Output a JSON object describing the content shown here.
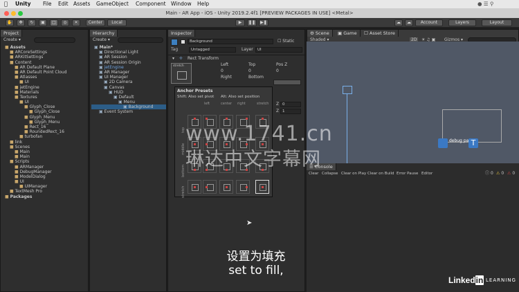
{
  "menubar": {
    "app": "Unity",
    "items": [
      "File",
      "Edit",
      "Assets",
      "GameObject",
      "Component",
      "Window",
      "Help"
    ]
  },
  "title": "Main - AR App - iOS - Unity 2019.2.4f1 [PREVIEW PACKAGES IN USE] <Metal>",
  "toolbar": {
    "center": "Center",
    "local": "Local",
    "account": "Account",
    "layers": "Layers",
    "layout": "Layout"
  },
  "project": {
    "tab": "Project",
    "create": "Create",
    "tree": [
      {
        "label": "Assets",
        "depth": 0,
        "bold": true
      },
      {
        "label": "ARCoreSettings",
        "depth": 1
      },
      {
        "label": "ARKitSettings",
        "depth": 1
      },
      {
        "label": "Content",
        "depth": 1
      },
      {
        "label": "AR Default Plane",
        "depth": 2
      },
      {
        "label": "AR Default Point Cloud",
        "depth": 2
      },
      {
        "label": "Atlasses",
        "depth": 2
      },
      {
        "label": "UI",
        "depth": 3
      },
      {
        "label": "jetEngine",
        "depth": 2
      },
      {
        "label": "Materials",
        "depth": 2
      },
      {
        "label": "Textures",
        "depth": 2
      },
      {
        "label": "UI",
        "depth": 3
      },
      {
        "label": "Glyph_Close",
        "depth": 4
      },
      {
        "label": "Glyph_Close",
        "depth": 5
      },
      {
        "label": "Glyph_Menu",
        "depth": 4
      },
      {
        "label": "Glyph_Menu",
        "depth": 5
      },
      {
        "label": "Rect_16",
        "depth": 4
      },
      {
        "label": "RoundedRect_16",
        "depth": 4
      },
      {
        "label": "turbofan",
        "depth": 3
      },
      {
        "label": "link",
        "depth": 1
      },
      {
        "label": "Scenes",
        "depth": 1
      },
      {
        "label": "Main",
        "depth": 2
      },
      {
        "label": "Main",
        "depth": 2
      },
      {
        "label": "Scripts",
        "depth": 1
      },
      {
        "label": "ARManager",
        "depth": 2
      },
      {
        "label": "DebugManager",
        "depth": 2
      },
      {
        "label": "ModelDialog",
        "depth": 2
      },
      {
        "label": "UI",
        "depth": 2
      },
      {
        "label": "UIManager",
        "depth": 3
      },
      {
        "label": "TextMesh Pro",
        "depth": 1
      },
      {
        "label": "Packages",
        "depth": 0,
        "bold": true
      }
    ]
  },
  "hierarchy": {
    "tab": "Hierarchy",
    "create": "Create",
    "tree": [
      {
        "label": "Main*",
        "depth": 0,
        "bold": true
      },
      {
        "label": "Directional Light",
        "depth": 1
      },
      {
        "label": "AR Session",
        "depth": 1
      },
      {
        "label": "AR Session Origin",
        "depth": 1
      },
      {
        "label": "jetEngine",
        "depth": 1,
        "blue": true
      },
      {
        "label": "AR Manager",
        "depth": 1
      },
      {
        "label": "UI Manager",
        "depth": 1
      },
      {
        "label": "2D Camera",
        "depth": 2
      },
      {
        "label": "Canvas",
        "depth": 2
      },
      {
        "label": "HUD",
        "depth": 3
      },
      {
        "label": "Default",
        "depth": 4
      },
      {
        "label": "Menu",
        "depth": 5
      },
      {
        "label": "Background",
        "depth": 6,
        "selected": true
      },
      {
        "label": "Event System",
        "depth": 1
      }
    ]
  },
  "inspector": {
    "tab": "Inspector",
    "name": "Background",
    "static": "Static",
    "tag_label": "Tag",
    "tag": "Untagged",
    "layer_label": "Layer",
    "layer": "UI",
    "component": "Rect Transform",
    "stretch": "stretch",
    "cols": [
      "Left",
      "Top",
      "Pos Z"
    ],
    "vals": [
      "0",
      "0",
      "0"
    ],
    "cols2": [
      "Right",
      "Bottom"
    ],
    "z": [
      "0",
      "1"
    ],
    "zl": "Z"
  },
  "presets": {
    "title": "Anchor Presets",
    "hint1": "Shift: Also set pivot",
    "hint2": "Alt: Also set position",
    "cols": [
      "left",
      "center",
      "right",
      "stretch"
    ],
    "rows": [
      "top",
      "middle",
      "bottom",
      "stretch"
    ]
  },
  "scene": {
    "tabs": [
      "Scene",
      "Game",
      "Asset Store"
    ],
    "shaded": "Shaded",
    "mode": "2D",
    "gizmos": "Gizmos",
    "label": "debug panel"
  },
  "console": {
    "tab": "Console",
    "buttons": [
      "Clear",
      "Collapse",
      "Clear on Play",
      "Clear on Build",
      "Error Pause",
      "Editor"
    ],
    "counts": [
      "0",
      "0",
      "0"
    ]
  },
  "watermark": {
    "url": "www.1741.cn",
    "cn": "琳达中文字幕网"
  },
  "subtitle": {
    "cn": "设置为填充",
    "en": "set to fill,"
  },
  "brand": {
    "a": "Linked",
    "b": "in",
    "c": "LEARNING"
  }
}
